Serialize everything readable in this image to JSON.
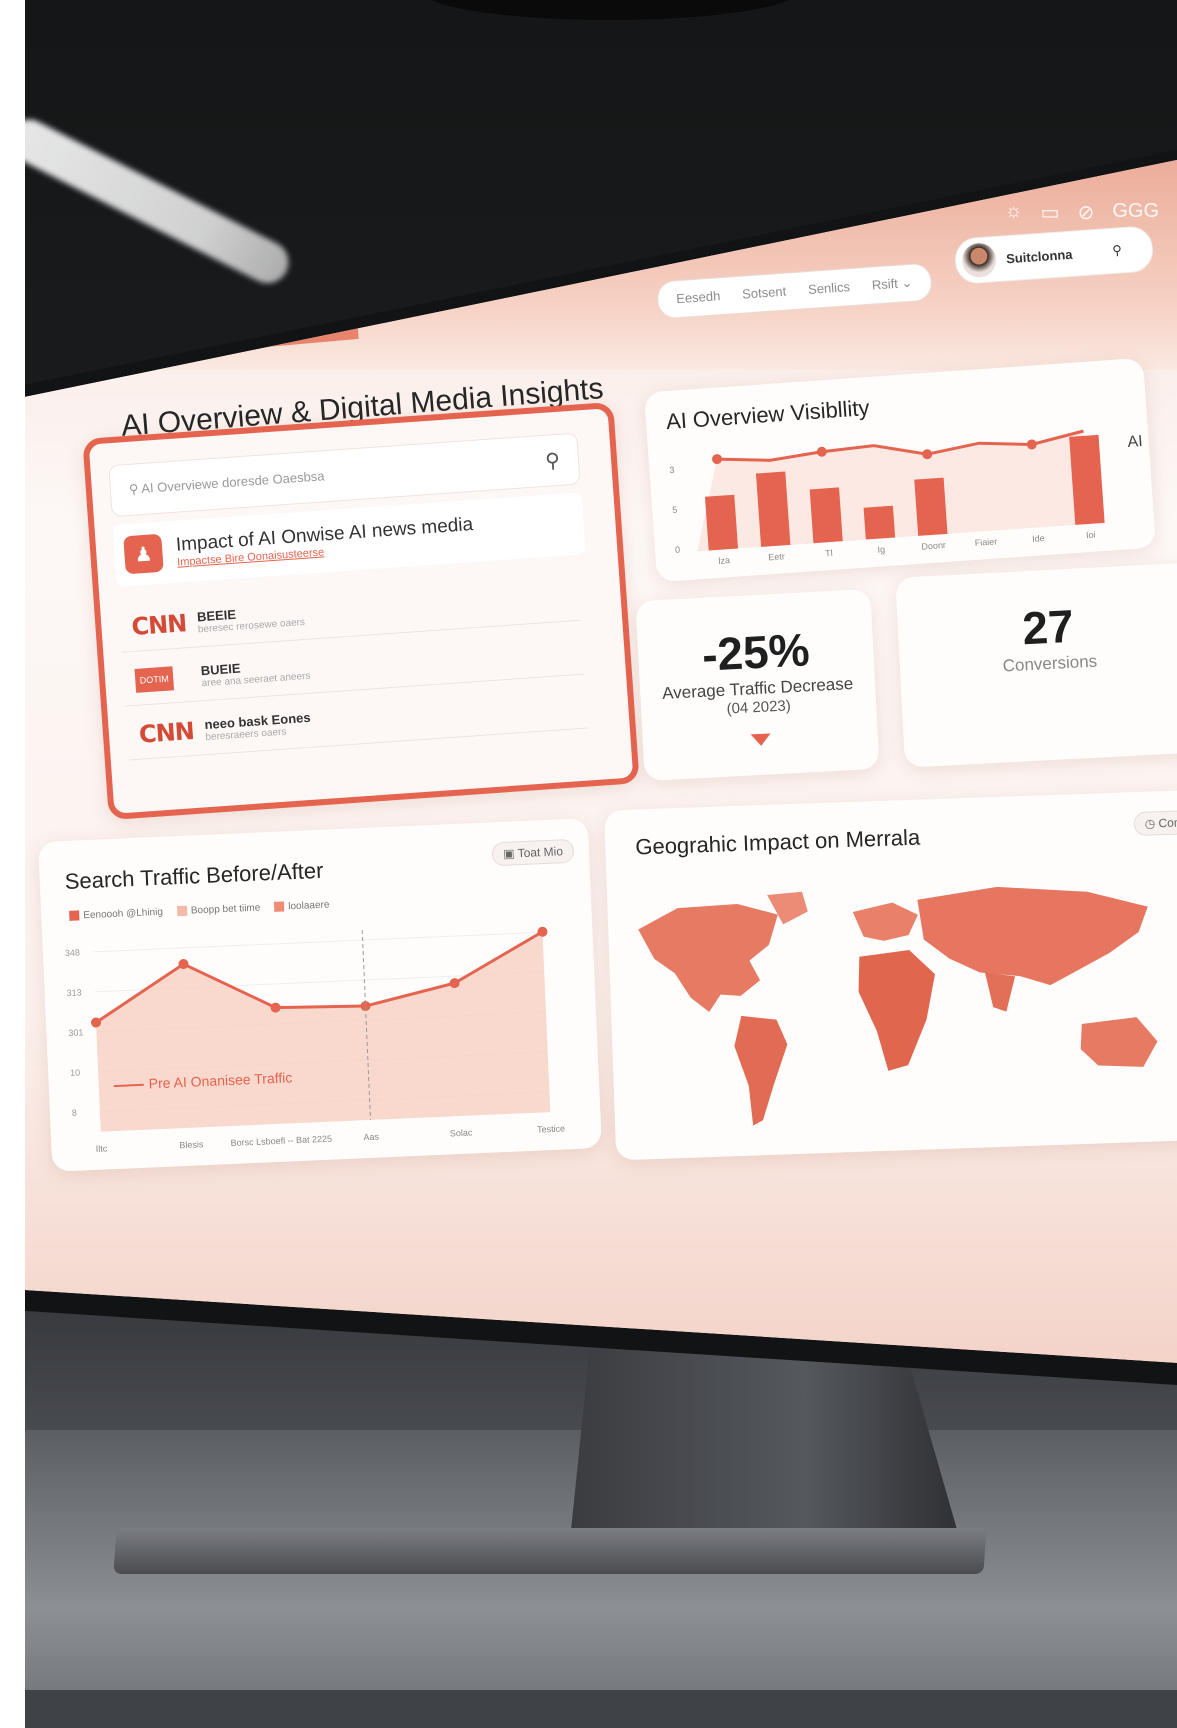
{
  "header": {
    "title": "AI Overview & Digital Media Insights",
    "nav": [
      "Eesedh",
      "Sotsent",
      "Senlics",
      "Rsift"
    ],
    "user": "Suitclonna",
    "top_icons": [
      "sun-icon",
      "window-icon",
      "link-icon",
      "settings-icon"
    ],
    "top_label": "GGG"
  },
  "search_card": {
    "placeholder": "AI Overviewe doresde Oaesbsa",
    "result_title": "Impact of AI Onwise AI news media",
    "result_link": "Impactse Bire Oonaisusteerse",
    "rows": [
      {
        "logo": "CNN",
        "name": "BEEIE",
        "sub": "beresec rerosewe oaers"
      },
      {
        "logo": "DOTIM",
        "name": "BUEIE",
        "sub": "aree ana seeraet aneers"
      },
      {
        "logo": "CNN",
        "name": "neeo bask Eones",
        "sub": "beresraeers oaers"
      }
    ]
  },
  "visibility": {
    "title": "AI Overview Visibllity",
    "side_label": "AI"
  },
  "stats": [
    {
      "value": "-25%",
      "label": "Average Traffic Decrease",
      "sub": "(04 2023)"
    },
    {
      "value": "27",
      "label": "Conversions"
    }
  ],
  "traffic": {
    "title": "Search Traffic Before/After",
    "button": "Toat Mio",
    "annotation": "Pre AI Onanisee Traffic",
    "legend": [
      {
        "label": "Eenoooh @Lhinig",
        "color": "#e4644f"
      },
      {
        "label": "Boopp bet tiime",
        "color": "#f4b9a8"
      },
      {
        "label": "loolaaere",
        "color": "#f08c74"
      }
    ]
  },
  "geo": {
    "title": "Geograhic Impact on Merrala",
    "button": "Comm"
  },
  "chart_data": [
    {
      "type": "bar",
      "title": "AI Overview Visibllity",
      "categories": [
        "lza",
        "Eetr",
        "Tl",
        "Ig",
        "Doonr",
        "Fiaier",
        "Ide",
        "Ioi"
      ],
      "values": [
        2.2,
        3.0,
        2.2,
        1.3,
        2.3,
        0,
        0,
        3.6
      ],
      "line": [
        3.7,
        3.5,
        3.7,
        3.8,
        3.3,
        3.6,
        3.4,
        3.8
      ],
      "yticks": [
        "0",
        "5",
        "3"
      ],
      "ylim": [
        0,
        4
      ]
    },
    {
      "type": "area",
      "title": "Search Traffic Before/After",
      "x": [
        "Iltc",
        "Blesis",
        "Borsc Lsboefl -- Bat 2225",
        "Aas",
        "Solac",
        "Testice"
      ],
      "values": [
        230,
        345,
        245,
        240,
        280,
        380
      ],
      "yticks": [
        "8",
        "10",
        "301",
        "313",
        "348"
      ],
      "ylim": [
        0,
        400
      ]
    }
  ]
}
